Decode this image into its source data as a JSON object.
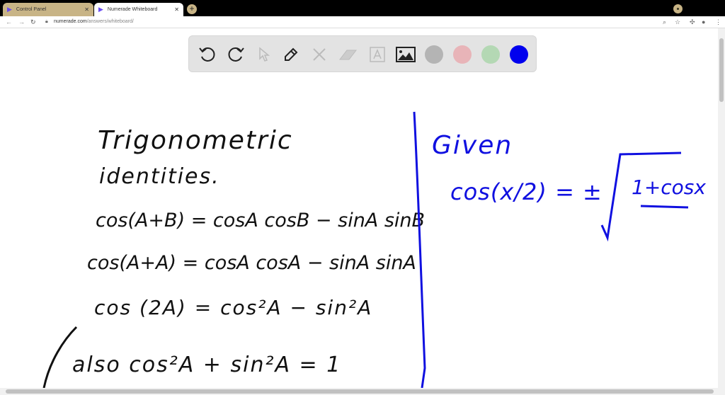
{
  "browser": {
    "tabs": [
      {
        "label": "Control Panel",
        "active": false
      },
      {
        "label": "Numerade Whiteboard",
        "active": true
      }
    ],
    "new_tab": "+",
    "url_host": "numerade.com",
    "url_path": "/answers/whiteboard/"
  },
  "toolbar": {
    "tools": [
      "undo-icon",
      "redo-icon",
      "select-icon",
      "pen-icon",
      "tools-icon",
      "eraser-icon",
      "text-icon",
      "image-icon"
    ],
    "colors": [
      "#b4b4b4",
      "#e8b4b8",
      "#b4d8b4",
      "#0000ee"
    ],
    "selected_color": "#0000ee"
  },
  "board": {
    "left": {
      "title1": "Trigonometric",
      "title2": "identities.",
      "line1": "cos(A+B) = cosA cosB − sinA sinB",
      "line2": "cos(A+A) = cosA cosA − sinA sinA",
      "line3": "cos (2A) = cos²A − sin²A",
      "line4": "also  cos²A + sin²A = 1"
    },
    "right": {
      "given": "Given",
      "lhs": "cos(x/2) = ±",
      "radicand": "1+cosx"
    }
  },
  "colors": {
    "ink_black": "#111111",
    "ink_blue": "#1010e0"
  }
}
